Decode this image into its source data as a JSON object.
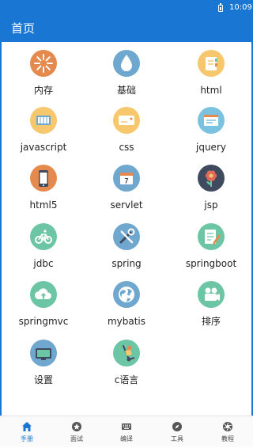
{
  "status_bar": {
    "time": "10:09"
  },
  "app_bar": {
    "title": "首页"
  },
  "grid": [
    {
      "label": "内存",
      "icon": "memory-icon",
      "bg": "#e58a4e"
    },
    {
      "label": "基础",
      "icon": "water-drop-icon",
      "bg": "#6fa7cf"
    },
    {
      "label": "html",
      "icon": "notebook-icon",
      "bg": "#f6c76d"
    },
    {
      "label": "javascript",
      "icon": "app-window-icon",
      "bg": "#f6c76d"
    },
    {
      "label": "css",
      "icon": "card-icon",
      "bg": "#f6c76d"
    },
    {
      "label": "jquery",
      "icon": "browser-icon",
      "bg": "#7bc2e0"
    },
    {
      "label": "html5",
      "icon": "smartphone-icon",
      "bg": "#e58a4e"
    },
    {
      "label": "servlet",
      "icon": "calendar-icon",
      "bg": "#6fa7cf"
    },
    {
      "label": "jsp",
      "icon": "flower-icon",
      "bg": "#3f4a5f"
    },
    {
      "label": "jdbc",
      "icon": "bicycle-icon",
      "bg": "#6cc5a5"
    },
    {
      "label": "spring",
      "icon": "tools-icon",
      "bg": "#6fa7cf"
    },
    {
      "label": "springboot",
      "icon": "edit-document-icon",
      "bg": "#6cc5a5"
    },
    {
      "label": "springmvc",
      "icon": "cloud-upload-icon",
      "bg": "#6cc5a5"
    },
    {
      "label": "mybatis",
      "icon": "globe-icon",
      "bg": "#6fa7cf"
    },
    {
      "label": "排序",
      "icon": "film-camera-icon",
      "bg": "#6cc5a5"
    },
    {
      "label": "设置",
      "icon": "monitor-icon",
      "bg": "#6fa7cf"
    },
    {
      "label": "c语言",
      "icon": "hand-truck-icon",
      "bg": "#6cc5a5"
    }
  ],
  "tabs": [
    {
      "label": "手册",
      "icon": "home-icon",
      "active": true
    },
    {
      "label": "面试",
      "icon": "star-icon",
      "active": false
    },
    {
      "label": "编译",
      "icon": "keyboard-icon",
      "active": false
    },
    {
      "label": "工具",
      "icon": "compass-icon",
      "active": false
    },
    {
      "label": "教程",
      "icon": "aperture-icon",
      "active": false
    }
  ],
  "colors": {
    "primary": "#1976d2",
    "tab_inactive": "#555555"
  }
}
